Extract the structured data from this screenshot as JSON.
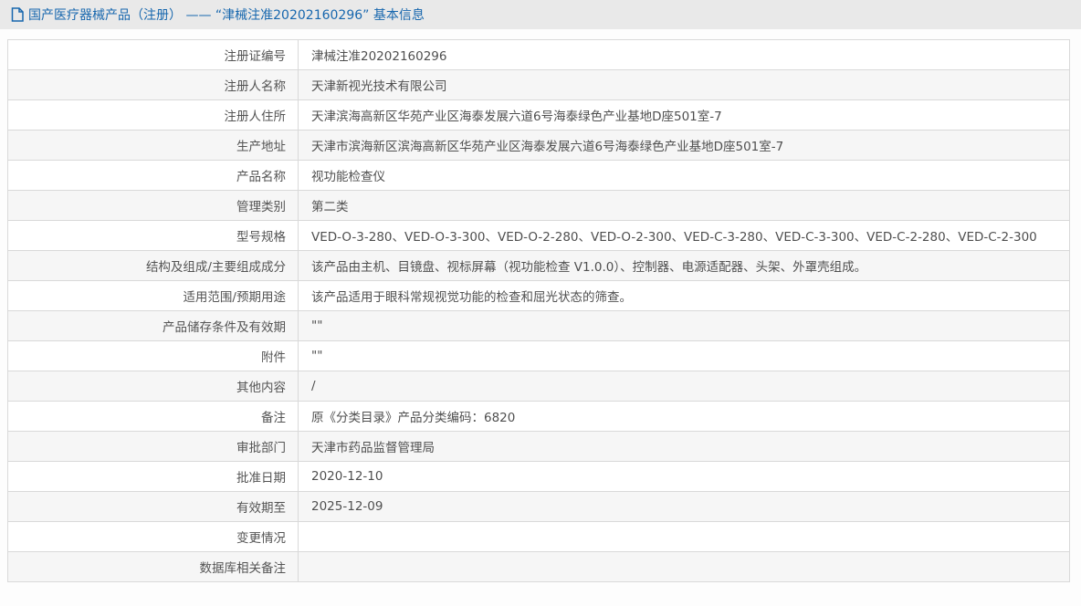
{
  "header": {
    "icon": "document-icon",
    "title": "国产医疗器械产品（注册） —— “津械注准20202160296” 基本信息"
  },
  "table": {
    "rows": [
      {
        "label": "注册证编号",
        "value": "津械注准20202160296"
      },
      {
        "label": "注册人名称",
        "value": "天津新视光技术有限公司"
      },
      {
        "label": "注册人住所",
        "value": "天津滨海高新区华苑产业区海泰发展六道6号海泰绿色产业基地D座501室-7"
      },
      {
        "label": "生产地址",
        "value": "天津市滨海新区滨海高新区华苑产业区海泰发展六道6号海泰绿色产业基地D座501室-7"
      },
      {
        "label": "产品名称",
        "value": "视功能检查仪"
      },
      {
        "label": "管理类别",
        "value": "第二类"
      },
      {
        "label": "型号规格",
        "value": "VED-O-3-280、VED-O-3-300、VED-O-2-280、VED-O-2-300、VED-C-3-280、VED-C-3-300、VED-C-2-280、VED-C-2-300"
      },
      {
        "label": "结构及组成/主要组成成分",
        "value": "该产品由主机、目镜盘、视标屏幕（视功能检查 V1.0.0）、控制器、电源适配器、头架、外罩壳组成。"
      },
      {
        "label": "适用范围/预期用途",
        "value": "该产品适用于眼科常规视觉功能的检查和屈光状态的筛查。"
      },
      {
        "label": "产品储存条件及有效期",
        "value": "\"\""
      },
      {
        "label": "附件",
        "value": "\"\""
      },
      {
        "label": "其他内容",
        "value": "/"
      },
      {
        "label": "备注",
        "value": "原《分类目录》产品分类编码：6820"
      },
      {
        "label": "审批部门",
        "value": "天津市药品监督管理局"
      },
      {
        "label": "批准日期",
        "value": "2020-12-10"
      },
      {
        "label": "有效期至",
        "value": "2025-12-09"
      },
      {
        "label": "变更情况",
        "value": ""
      },
      {
        "label": "数据库相关备注",
        "value": ""
      }
    ]
  },
  "colors": {
    "accent_blue": "#1767ae",
    "header_bar_bg": "#e9e9e9",
    "row_alt_bg": "#f6f6f6",
    "table_border": "#d9d9d9",
    "text": "#545454"
  }
}
